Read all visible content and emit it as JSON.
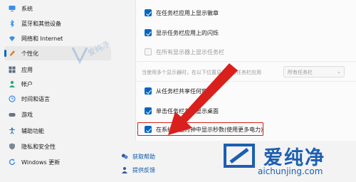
{
  "sidebar": {
    "items": [
      {
        "label": "系统",
        "icon": "monitor-icon"
      },
      {
        "label": "蓝牙和其他设备",
        "icon": "bluetooth-icon"
      },
      {
        "label": "网络和 Internet",
        "icon": "wifi-icon"
      },
      {
        "label": "个性化",
        "icon": "brush-icon"
      },
      {
        "label": "应用",
        "icon": "apps-icon"
      },
      {
        "label": "帐户",
        "icon": "person-icon"
      },
      {
        "label": "时间和语言",
        "icon": "globe-clock-icon"
      },
      {
        "label": "游戏",
        "icon": "gamepad-icon"
      },
      {
        "label": "辅助功能",
        "icon": "accessibility-icon"
      },
      {
        "label": "隐私和安全性",
        "icon": "shield-icon"
      },
      {
        "label": "Windows 更新",
        "icon": "update-icon"
      }
    ],
    "active_index": 3
  },
  "settings": {
    "badges": {
      "label": "在任务栏应用上显示徽章",
      "checked": true
    },
    "flashing": {
      "label": "显示任务栏应用上的闪烁",
      "checked": true
    },
    "all_displays": {
      "label": "在所有显示器上显示任务栏",
      "checked": false
    },
    "multi_display": {
      "label": "当使用多个显示器时，在以下位置显示我的任务栏应用",
      "value": "所有任务栏"
    },
    "share_window": {
      "label": "从任务栏共享任何窗口",
      "checked": true
    },
    "show_desktop": {
      "label": "单击任务栏右下显示桌面",
      "checked": true
    },
    "show_seconds": {
      "label": "在系统托盘时钟中显示秒数(使用更多电力)",
      "checked": true
    }
  },
  "links": {
    "help": "获取帮助",
    "feedback": "提供反馈"
  },
  "watermark": {
    "center": "爱纯净",
    "brand_name": "爱纯净",
    "brand_url": "aichunjing.com"
  },
  "colors": {
    "accent": "#0067c0",
    "highlight": "#d9201c",
    "arrow": "#d9201c",
    "brand": "#1c5fb0"
  }
}
